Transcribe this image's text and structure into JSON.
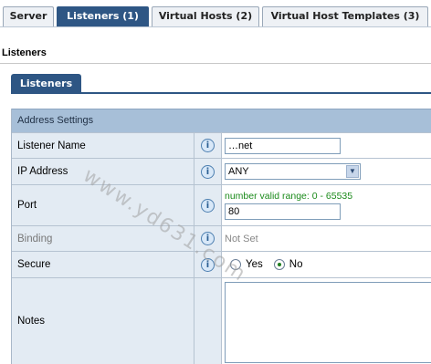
{
  "tabs": [
    {
      "label": "Server",
      "active": false
    },
    {
      "label": "Listeners (1)",
      "active": true
    },
    {
      "label": "Virtual Hosts (2)",
      "active": false
    },
    {
      "label": "Virtual Host Templates (3)",
      "active": false
    }
  ],
  "page_title": "Listeners",
  "subtab": "Listeners",
  "section_header": "Address Settings",
  "fields": {
    "listener_name": {
      "label": "Listener Name",
      "value": "…net"
    },
    "ip_address": {
      "label": "IP Address",
      "value": "ANY"
    },
    "port": {
      "label": "Port",
      "hint": "number valid range: 0 - 65535",
      "value": "80"
    },
    "binding": {
      "label": "Binding",
      "value": "Not Set"
    },
    "secure": {
      "label": "Secure",
      "options": [
        "Yes",
        "No"
      ],
      "selected": "No"
    },
    "notes": {
      "label": "Notes",
      "value": ""
    }
  },
  "info_icon_glyph": "i",
  "watermark": "www.yd631.com",
  "colors": {
    "accent": "#2e5684",
    "section_header": "#a7bfd8",
    "label_bg": "#e3ebf3",
    "hint": "#1a8a1a"
  }
}
